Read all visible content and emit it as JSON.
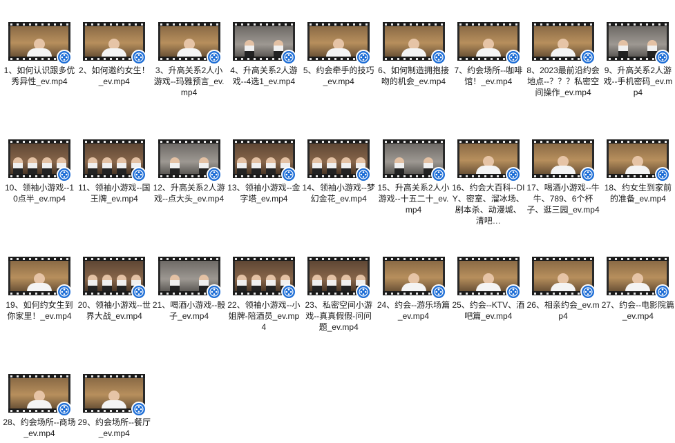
{
  "icons": {
    "file_badge": "video-player-icon",
    "badge_color": "#1e6ed6"
  },
  "files": [
    {
      "name": "1、如何认识跟多优秀异性_ev.mp4",
      "scene": "a"
    },
    {
      "name": "2、如何邀约女生！_ev.mp4",
      "scene": "a"
    },
    {
      "name": "3、升高关系2人小游戏--玛雅预言_ev.mp4",
      "scene": "a"
    },
    {
      "name": "4、升高关系2人游戏--4选1_ev.mp4",
      "scene": "b"
    },
    {
      "name": "5、约会牵手的技巧_ev.mp4",
      "scene": "a"
    },
    {
      "name": "6、如何制造拥抱接吻的机会_ev.mp4",
      "scene": "a"
    },
    {
      "name": "7、约会场所--咖啡馆！_ev.mp4",
      "scene": "a"
    },
    {
      "name": "8、2023最前沿约会地点--？？？私密空间操作_ev.mp4",
      "scene": "a"
    },
    {
      "name": "9、升高关系2人游戏--手机密码_ev.mp4",
      "scene": "b"
    },
    {
      "name": "10、领袖小游戏--10点半_ev.mp4",
      "scene": "c"
    },
    {
      "name": "11、领袖小游戏--国王牌_ev.mp4",
      "scene": "c"
    },
    {
      "name": "12、升高关系2人游戏--点大头_ev.mp4",
      "scene": "b"
    },
    {
      "name": "13、领袖小游戏--金字塔_ev.mp4",
      "scene": "c"
    },
    {
      "name": "14、领袖小游戏--梦幻金花_ev.mp4",
      "scene": "c"
    },
    {
      "name": "15、升高关系2人小游戏--十五二十_ev.mp4",
      "scene": "b"
    },
    {
      "name": "16、约会大百科--DIY、密室、溜冰场、剧本杀、动漫城、清吧…",
      "scene": "a"
    },
    {
      "name": "17、喝酒小游戏--牛牛、789、6个杯子、逛三园_ev.mp4",
      "scene": "a"
    },
    {
      "name": "18、约女生到家前的准备_ev.mp4",
      "scene": "a"
    },
    {
      "name": "19、如何约女生到你家里！_ev.mp4",
      "scene": "a"
    },
    {
      "name": "20、领袖小游戏--世界大战_ev.mp4",
      "scene": "c"
    },
    {
      "name": "21、喝酒小游戏--骰子_ev.mp4",
      "scene": "b"
    },
    {
      "name": "22、领袖小游戏--小姐牌-陪酒员_ev.mp4",
      "scene": "c"
    },
    {
      "name": "23、私密空间小游戏--真真假假-问问题_ev.mp4",
      "scene": "c"
    },
    {
      "name": "24、约会--游乐场篇_ev.mp4",
      "scene": "a"
    },
    {
      "name": "25、约会--KTV、酒吧篇_ev.mp4",
      "scene": "a"
    },
    {
      "name": "26、相亲约会_ev.mp4",
      "scene": "a"
    },
    {
      "name": "27、约会--电影院篇_ev.mp4",
      "scene": "a"
    },
    {
      "name": "28、约会场所--商场_ev.mp4",
      "scene": "a"
    },
    {
      "name": "29、约会场所--餐厅_ev.mp4",
      "scene": "a"
    }
  ]
}
